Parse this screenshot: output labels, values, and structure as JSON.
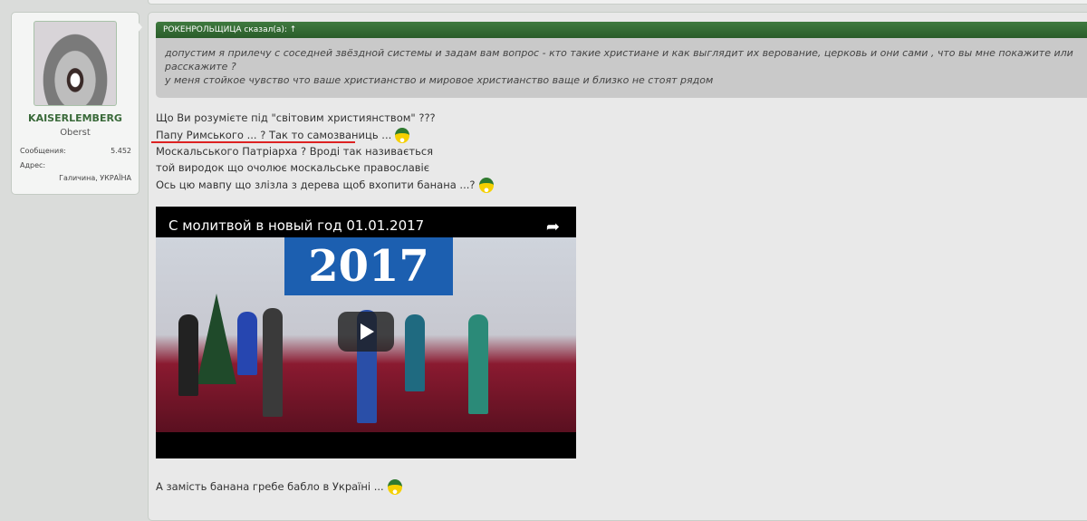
{
  "user": {
    "name": "KAISERLEMBERG",
    "rank": "Oberst",
    "messages_label": "Сообщения:",
    "messages_value": "5.452",
    "address_label": "Адрес:",
    "address_value": "Галичина, УКРАЇНА"
  },
  "quote": {
    "header": "РОКЕНРОЛЬЩИЦА сказал(а): ↑",
    "lines": [
      "допустим я прилечу с соседней звёздной системы и задам вам вопрос - кто такие христиане и как выглядит их верование, церковь и они сами , что вы мне покажите или расскажите ?",
      "у меня стойкое чувство что ваше христианство и мировое христианство ваще и близко не стоят рядом"
    ]
  },
  "post": {
    "lines": [
      "Що Ви розумієте під \"світовим християнством\" ???",
      "Папу Римського ... ? Так то самозваниць ...",
      "Москальського Патріарха ? Вроді так називається",
      "той виродок що очолює москальське православіє",
      "Ось цю мавпу що злізла з дерева щоб вхопити банана ...?"
    ],
    "last_line": "А замість банана гребе бабло в Україні ..."
  },
  "video": {
    "title": "С молитвой в новый год 01.01.2017",
    "banner": "2017"
  },
  "colors": {
    "quote_header": "#2f6a2f",
    "username": "#3a6a3a",
    "underline": "#d22222"
  }
}
